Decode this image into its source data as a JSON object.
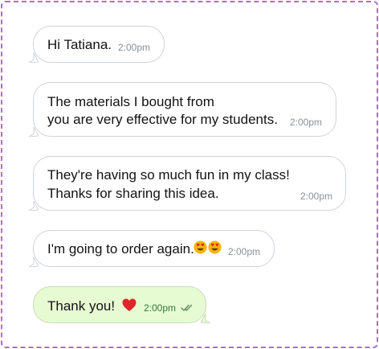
{
  "conversation": {
    "messages": [
      {
        "direction": "incoming",
        "lines": [
          "Hi Tatiana."
        ],
        "time": "2:00pm"
      },
      {
        "direction": "incoming",
        "lines": [
          "The materials I bought from",
          "you are very effective for my students."
        ],
        "time": "2:00pm"
      },
      {
        "direction": "incoming",
        "lines": [
          "They're having so much fun in my class!",
          "Thanks for sharing this idea."
        ],
        "time": "2:00pm"
      },
      {
        "direction": "incoming",
        "text": "I'm going to order again.",
        "emoji": "heart-eyes-emoji x2",
        "time": "2:00pm"
      },
      {
        "direction": "outgoing",
        "text": "Thank you!",
        "emoji": "red-heart-emoji",
        "time": "2:00pm",
        "status": "read-double-check-icon"
      }
    ]
  },
  "colors": {
    "frame_border": "#a86be0",
    "incoming_bg": "#ffffff",
    "incoming_border": "#cfd3d8",
    "outgoing_bg": "#e7fbd3",
    "outgoing_border": "#c8dcb6",
    "timestamp": "#8a9098",
    "text": "#121212",
    "heart": "#e0262a",
    "heart_eyes_face": "#f4b400"
  }
}
